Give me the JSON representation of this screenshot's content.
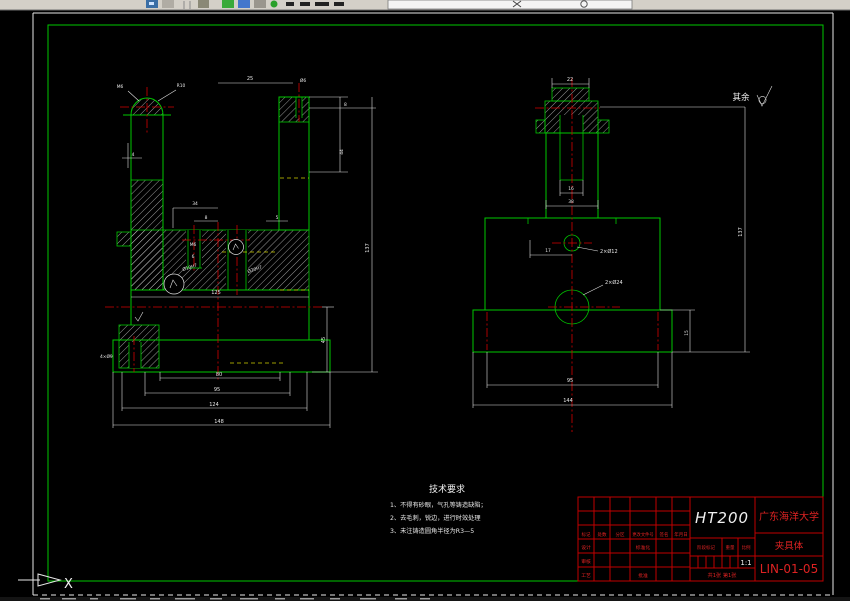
{
  "window": {
    "app_type": "CAD drawing viewport",
    "toolbar_icons": [
      "toolbar-icon-fragment-1",
      "toolbar-icon-fragment-2",
      "toolbar-icon-fragment-3",
      "toolbar-icon-fragment-4",
      "toolbar-icon-fragment-5",
      "toolbar-icon-fragment-6",
      "toolbar-icon-fragment-7",
      "toolbar-combobox",
      "toolbar-icon-fragment-8",
      "toolbar-icon-fragment-9"
    ]
  },
  "colors": {
    "background": "#000000",
    "geometry_green": "#00c800",
    "centerline_red": "#d40000",
    "hidden_yellow": "#cfcf00",
    "dimension_white": "#e8e8e8",
    "titleblock_red": "#c00000",
    "toolbar_gray": "#d4d0c8"
  },
  "drawing": {
    "left_dims": [
      "M6",
      "R10",
      "25",
      "Ø6",
      "8",
      "44",
      "137",
      "4",
      "34",
      "8",
      "5",
      "M6",
      "6",
      "Ø10H7",
      "Ø20H7",
      "125",
      "45",
      "4×Ø9",
      "80",
      "95",
      "124",
      "148"
    ],
    "right_dims": [
      "22",
      "16",
      "38",
      "17",
      "2×Ø12",
      "2×Ø24",
      "95",
      "144",
      "15",
      "137"
    ]
  },
  "annotations": {
    "surface_note": "其余"
  },
  "tech_req": {
    "title": "技术要求",
    "items": [
      "1、不得有砂眼，气孔等铸造缺陷；",
      "2、去毛刺，锐边，进行时效处理",
      "3、未注铸造圆角半径为R3—5"
    ]
  },
  "title_block": {
    "material": "HT200",
    "org": "广东海洋大学",
    "part_name": "夹具体",
    "drawing_no": "LIN-01-05",
    "scale": "1:1",
    "sheet_note": "共1张 第1张",
    "col_headers": [
      "标记",
      "处数",
      "分区",
      "更改文件号",
      "签名",
      "年月日"
    ],
    "row_labels": {
      "design": "设计",
      "standardize": "标准化",
      "check": "审核",
      "process": "工艺",
      "approve": "批准",
      "stage": "阶段标记",
      "weight": "重量",
      "ratio": "比例"
    }
  },
  "ucs": {
    "axis_label": "X"
  }
}
